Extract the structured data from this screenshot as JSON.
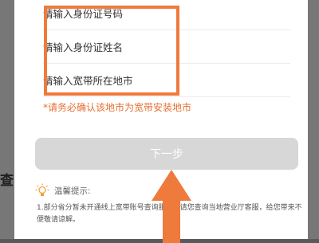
{
  "background": {
    "partial_title": "查询"
  },
  "form": {
    "fields": [
      {
        "placeholder": "请输入身份证号码"
      },
      {
        "placeholder": "请输入身份证姓名"
      },
      {
        "placeholder": "请输入宽带所在地市"
      }
    ],
    "warning": "*请务必确认该地市为宽带安装地市",
    "next_button_label": "下一步",
    "next_button_enabled": false
  },
  "tips": {
    "icon": "lightbulb-icon",
    "title": "温馨提示:",
    "body": "1.部分省分暂未开通线上宽带账号查询服务，请您查询当地营业厅客服，给您带来不便敬请谅解。"
  },
  "annotation": {
    "highlight_color": "#ee7a3c",
    "arrow_color": "#ee7a3c"
  },
  "colors": {
    "accent": "#e56f34",
    "button_disabled": "#d7d7d7"
  }
}
